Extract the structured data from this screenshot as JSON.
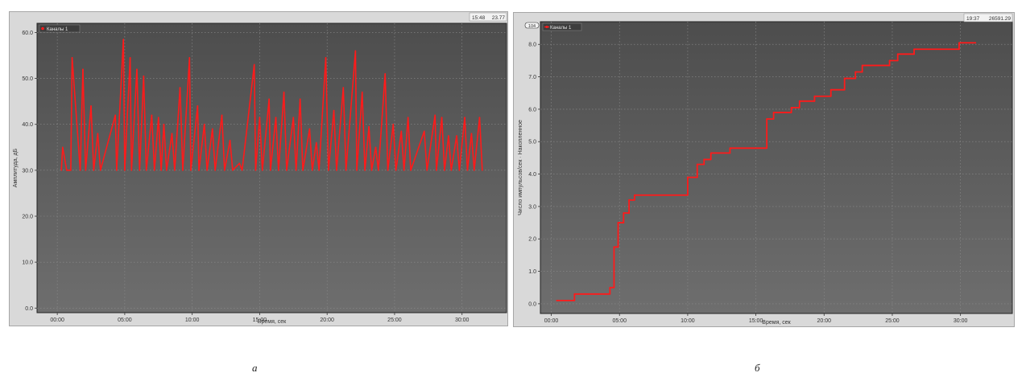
{
  "captions": [
    "а",
    "б"
  ],
  "colors": {
    "plot_bg_top": "#4d4d4d",
    "plot_bg_bottom": "#6e6e6e",
    "frame": "#d9d9d9",
    "series": "#ff1a1a",
    "grid": "#8c8c8c",
    "text": "#333333"
  },
  "chart_data": [
    {
      "type": "line",
      "status": {
        "time": "15:48",
        "value": "23.77"
      },
      "legend": [
        "Каналы 1"
      ],
      "legend_placement": "top-left",
      "ylabel": "Амплитуда, дБ",
      "xlabel": "Время, сек",
      "xlim": [
        -1.5,
        33.3
      ],
      "ylim": [
        -1,
        62
      ],
      "yticks": [
        0,
        10,
        20,
        30,
        40,
        50,
        60
      ],
      "ytick_labels": [
        "0.0",
        "10.0",
        "20.0",
        "30.0",
        "40.0",
        "50.0",
        "60.0"
      ],
      "xticks": [
        0,
        5,
        10,
        15,
        20,
        25,
        30
      ],
      "xtick_labels": [
        "00:00",
        "05:00",
        "10:00",
        "15:00",
        "20:00",
        "25:00",
        "30:00"
      ],
      "grid": true,
      "series": [
        {
          "name": "Каналы 1",
          "x": [
            0.3,
            0.4,
            0.7,
            1.0,
            1.1,
            1.7,
            1.9,
            2.1,
            2.5,
            2.7,
            3.0,
            3.2,
            4.3,
            4.4,
            4.9,
            5.0,
            5.4,
            5.5,
            5.9,
            6.1,
            6.4,
            6.6,
            7.0,
            7.2,
            7.5,
            7.7,
            7.9,
            8.1,
            8.5,
            8.7,
            9.1,
            9.3,
            9.8,
            9.9,
            10.4,
            10.5,
            10.9,
            11.1,
            11.5,
            11.7,
            12.2,
            12.4,
            12.8,
            13.0,
            13.5,
            13.7,
            14.6,
            14.7,
            15.0,
            15.2,
            15.7,
            15.8,
            16.2,
            16.4,
            16.8,
            17.0,
            17.5,
            17.7,
            18.0,
            18.2,
            18.7,
            18.9,
            19.2,
            19.4,
            19.9,
            20.1,
            20.5,
            20.7,
            21.2,
            21.4,
            22.1,
            22.2,
            22.6,
            22.8,
            23.1,
            23.3,
            23.6,
            23.8,
            24.3,
            24.5,
            24.9,
            25.1,
            25.5,
            25.7,
            26.0,
            26.2,
            27.2,
            27.4,
            28.0,
            28.1,
            28.5,
            28.7,
            29.0,
            29.2,
            29.6,
            29.8,
            30.2,
            30.4,
            30.7,
            30.9,
            31.3,
            31.5
          ],
          "y": [
            30.0,
            35.0,
            30.0,
            30.0,
            54.5,
            30.0,
            52.0,
            30.0,
            44.0,
            30.0,
            38.0,
            30.0,
            42.0,
            30.0,
            58.5,
            30.0,
            54.5,
            30.0,
            52.0,
            30.0,
            50.5,
            30.0,
            42.0,
            30.0,
            41.5,
            30.0,
            40.0,
            30.0,
            38.0,
            30.0,
            48.0,
            30.0,
            54.5,
            30.0,
            44.0,
            30.0,
            40.0,
            30.0,
            39.0,
            30.0,
            42.0,
            30.0,
            36.5,
            30.0,
            31.5,
            30.0,
            53.0,
            30.0,
            41.5,
            30.0,
            45.5,
            30.0,
            41.5,
            30.0,
            47.0,
            30.0,
            41.5,
            30.0,
            45.5,
            30.0,
            39.0,
            30.0,
            36.0,
            30.0,
            54.5,
            30.0,
            43.0,
            30.0,
            48.0,
            30.0,
            56.0,
            30.0,
            47.0,
            30.0,
            39.5,
            30.0,
            35.0,
            30.0,
            51.0,
            30.0,
            40.0,
            30.0,
            38.5,
            30.0,
            41.5,
            30.0,
            38.5,
            30.0,
            42.0,
            30.0,
            41.5,
            30.0,
            37.5,
            30.0,
            37.5,
            30.0,
            41.5,
            30.0,
            38.0,
            30.0,
            41.5,
            30.0
          ]
        }
      ]
    },
    {
      "type": "line",
      "status": {
        "time": "19:37",
        "value": "26591.29"
      },
      "legend": [
        "Каналы 1"
      ],
      "legend_placement": "top-left",
      "scale_tag": "104",
      "ylabel": "Число импульсов/сек · Накопленное",
      "xlabel": "Время, сек",
      "xlim": [
        -0.8,
        33.8
      ],
      "ylim": [
        -0.3,
        8.7
      ],
      "yticks": [
        0,
        1,
        2,
        3,
        4,
        5,
        6,
        7,
        8
      ],
      "ytick_labels": [
        "0.0",
        "1.0",
        "2.0",
        "3.0",
        "4.0",
        "5.0",
        "6.0",
        "7.0",
        "8.0"
      ],
      "xticks": [
        0,
        5,
        10,
        15,
        20,
        25,
        30
      ],
      "xtick_labels": [
        "00:00",
        "05:00",
        "10:00",
        "15:00",
        "20:00",
        "25:00",
        "30:00"
      ],
      "grid": true,
      "series": [
        {
          "name": "Каналы 1",
          "step": true,
          "x": [
            0.4,
            1.7,
            4.3,
            4.6,
            4.9,
            5.3,
            5.7,
            6.1,
            6.6,
            7.2,
            10.0,
            10.7,
            11.2,
            11.7,
            13.1,
            15.8,
            16.3,
            17.6,
            18.2,
            19.3,
            20.5,
            21.5,
            22.3,
            22.8,
            23.4,
            24.8,
            25.4,
            26.6,
            28.5,
            29.9,
            31.1
          ],
          "y": [
            0.1,
            0.3,
            0.5,
            1.75,
            2.5,
            2.8,
            3.2,
            3.35,
            3.35,
            3.35,
            3.9,
            4.3,
            4.45,
            4.65,
            4.8,
            5.7,
            5.9,
            6.05,
            6.25,
            6.4,
            6.6,
            6.95,
            7.15,
            7.35,
            7.35,
            7.5,
            7.7,
            7.85,
            7.85,
            8.05,
            8.05
          ]
        }
      ]
    }
  ]
}
